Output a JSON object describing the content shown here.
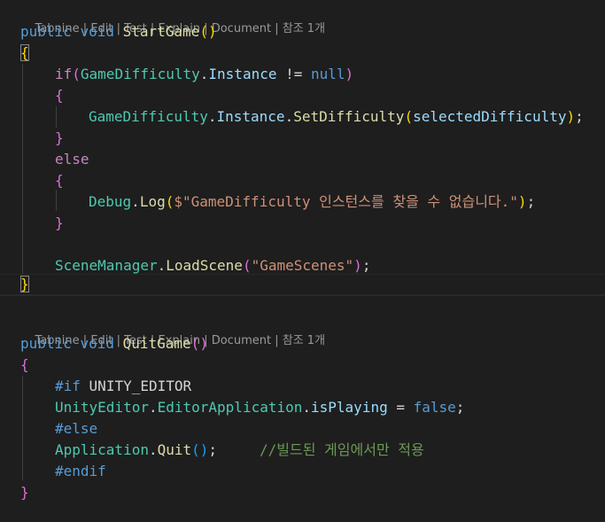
{
  "codelens": {
    "items": [
      "Tabnine",
      "Edit",
      "Test",
      "Explain",
      "Document",
      "참조 1개"
    ],
    "separator": "|"
  },
  "block1": {
    "l1": {
      "kw1": "public",
      "kw2": "void",
      "fn": "StartGame",
      "open": "(",
      "close": ")"
    },
    "l2": {
      "brace": "{"
    },
    "l3": {
      "kw": "if",
      "open": "(",
      "cls": "GameDifficulty",
      "dot": ".",
      "prop": "Instance",
      "op": " != ",
      "null": "null",
      "close": ")"
    },
    "l4": {
      "brace": "{"
    },
    "l5": {
      "cls": "GameDifficulty",
      "dot1": ".",
      "prop": "Instance",
      "dot2": ".",
      "fn": "SetDifficulty",
      "open": "(",
      "arg": "selectedDifficulty",
      "close": ")",
      "semi": ";"
    },
    "l6": {
      "brace": "}"
    },
    "l7": {
      "kw": "else"
    },
    "l8": {
      "brace": "{"
    },
    "l9": {
      "cls": "Debug",
      "dot": ".",
      "fn": "Log",
      "open": "(",
      "str": "$\"GameDifficulty 인스턴스를 찾을 수 없습니다.\"",
      "close": ")",
      "semi": ";"
    },
    "l10": {
      "brace": "}"
    },
    "l11": {
      "cls": "SceneManager",
      "dot": ".",
      "fn": "LoadScene",
      "open": "(",
      "str": "\"GameScenes\"",
      "close": ")",
      "semi": ";"
    },
    "l12": {
      "brace": "}"
    }
  },
  "block2": {
    "l1": {
      "kw1": "public",
      "kw2": "void",
      "fn": "QuitGame",
      "open": "(",
      "close": ")"
    },
    "l2": {
      "brace": "{"
    },
    "l3": {
      "pre": "#if",
      "sym": "UNITY_EDITOR"
    },
    "l4": {
      "cls1": "UnityEditor",
      "dot1": ".",
      "cls2": "EditorApplication",
      "dot2": ".",
      "prop": "isPlaying",
      "op": " = ",
      "val": "false",
      "semi": ";"
    },
    "l5": {
      "pre": "#else"
    },
    "l6": {
      "cls": "Application",
      "dot": ".",
      "fn": "Quit",
      "open": "(",
      "close": ")",
      "semi": ";",
      "cmt": "//빌드된 게임에서만 적용"
    },
    "l7": {
      "pre": "#endif"
    },
    "l8": {
      "brace": "}"
    }
  },
  "colors": {
    "background": "#1e1e1e",
    "keyword": "#569cd6",
    "function": "#dcdcaa",
    "class": "#4ec9b0",
    "property": "#9cdcfe",
    "string": "#ce9178",
    "control": "#c586c0",
    "comment": "#6a9955",
    "bracket1": "#ffd700",
    "bracket2": "#da70d6",
    "bracket3": "#179fff"
  }
}
